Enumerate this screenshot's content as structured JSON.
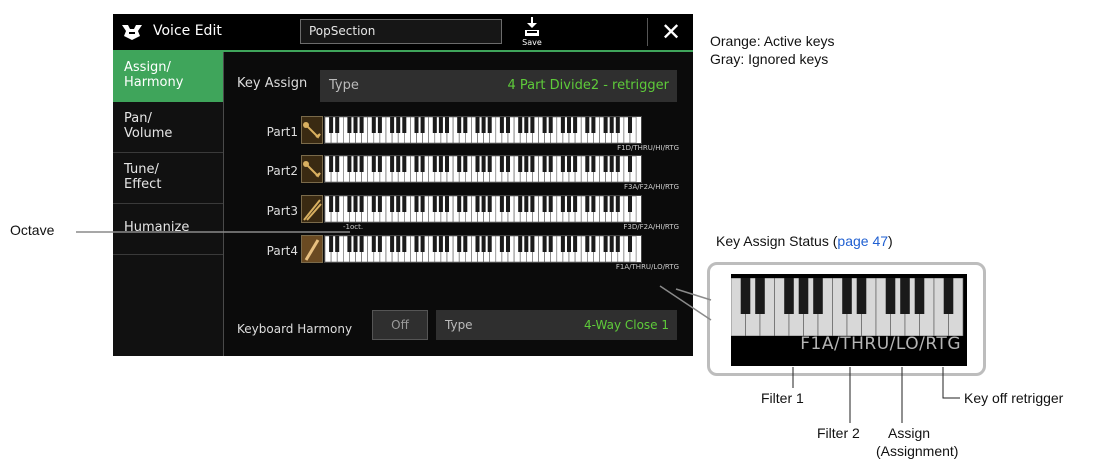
{
  "window": {
    "title": "Voice Edit",
    "voice_name": "PopSection",
    "save_label": "Save",
    "close_glyph": "✕"
  },
  "sidebar": {
    "items": [
      {
        "label": "Assign/\nHarmony",
        "active": true
      },
      {
        "label": "Pan/\nVolume",
        "active": false
      },
      {
        "label": "Tune/\nEffect",
        "active": false
      },
      {
        "label": "Humanize",
        "active": false
      }
    ]
  },
  "key_assign": {
    "label": "Key Assign",
    "type_label": "Type",
    "type_value": "4 Part Divide2 - retrigger"
  },
  "parts": [
    {
      "name": "Part1",
      "filter": "F1D/THRU/HI/RTG",
      "instrument_icon": "trumpet-icon"
    },
    {
      "name": "Part2",
      "filter": "F3A/F2A/HI/RTG",
      "instrument_icon": "trumpet-icon"
    },
    {
      "name": "Part3",
      "filter": "F3D/F2A/HI/RTG",
      "instrument_icon": "trombone-icon",
      "octave": "-1oct."
    },
    {
      "name": "Part4",
      "filter": "F1A/THRU/LO/RTG",
      "instrument_icon": "saxophone-icon"
    }
  ],
  "keyboard_harmony": {
    "label": "Keyboard Harmony",
    "switch": "Off",
    "type_label": "Type",
    "type_value": "4-Way Close 1"
  },
  "legend": {
    "orange": "Orange: Active keys",
    "gray": "Gray: Ignored keys"
  },
  "callouts": {
    "octave": "Octave",
    "status_title": "Key Assign Status (",
    "status_link": "page 47",
    "status_close": ")",
    "zoom_text": "F1A/THRU/LO/RTG",
    "filter1": "Filter 1",
    "filter2": "Filter 2",
    "assign_line1": "Assign",
    "assign_line2": "(Assignment)",
    "retrigger": "Key off retrigger"
  },
  "colors": {
    "accent": "#3fa55b",
    "value_text": "#5ecb3a",
    "link": "#1f5fd1"
  }
}
